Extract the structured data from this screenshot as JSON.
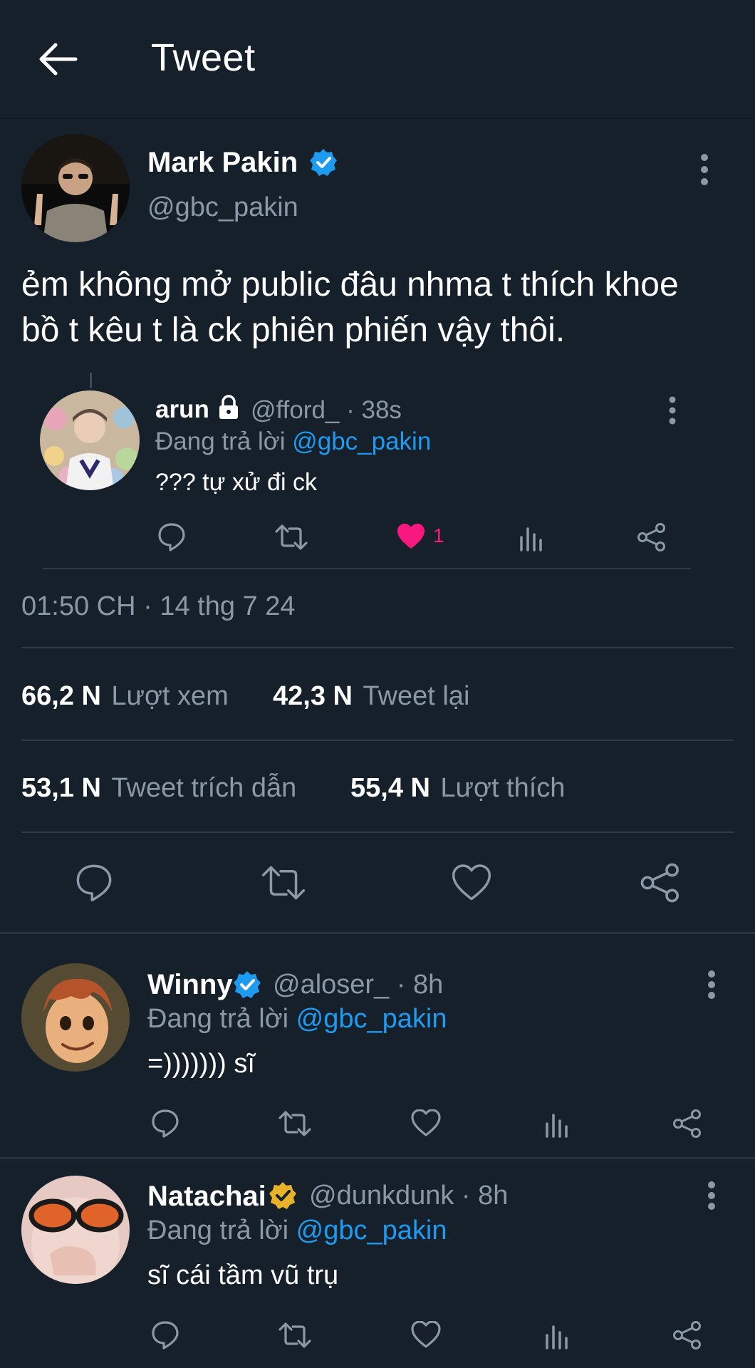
{
  "header": {
    "title": "Tweet",
    "back_icon": "arrow-left-icon"
  },
  "main_tweet": {
    "name": "Mark Pakin",
    "handle": "@gbc_pakin",
    "verified": "blue",
    "text": "ẻm không mở public đâu nhma t thích khoe\nbồ t kêu t là ck phiên phiến vậy thôi.",
    "quoted_reply": {
      "name": "arun",
      "handle_time": "@fford_ · 38s",
      "replying_label": "Đang trả lời ",
      "replying_to": "@gbc_pakin",
      "text": "??? tự xử đi ck",
      "like_count": "1",
      "liked": true
    },
    "timestamp": "01:50 CH · 14 thg 7 24",
    "stats": {
      "views_num": "66,2 N",
      "views_label": "Lượt xem",
      "retweets_num": "42,3 N",
      "retweets_label": "Tweet lại",
      "quotes_num": "53,1 N",
      "quotes_label": "Tweet trích dẫn",
      "likes_num": "55,4 N",
      "likes_label": "Lượt thích"
    }
  },
  "replies": [
    {
      "name": "Winny",
      "verified": "blue",
      "handle_time": "@aloser_ · 8h",
      "replying_label": "Đang trả lời ",
      "replying_to": "@gbc_pakin",
      "text": "=))))))) sĩ"
    },
    {
      "name": "Natachai",
      "verified": "gold",
      "handle_time": "@dunkdunk · 8h",
      "replying_label": "Đang trả lời ",
      "replying_to": "@gbc_pakin",
      "text": "sĩ cái tầm vũ trụ"
    }
  ],
  "colors": {
    "background": "#15202b",
    "accent": "#1d9bf0",
    "like": "#f91880",
    "gold": "#e8b32a",
    "muted": "#8b98a5"
  }
}
